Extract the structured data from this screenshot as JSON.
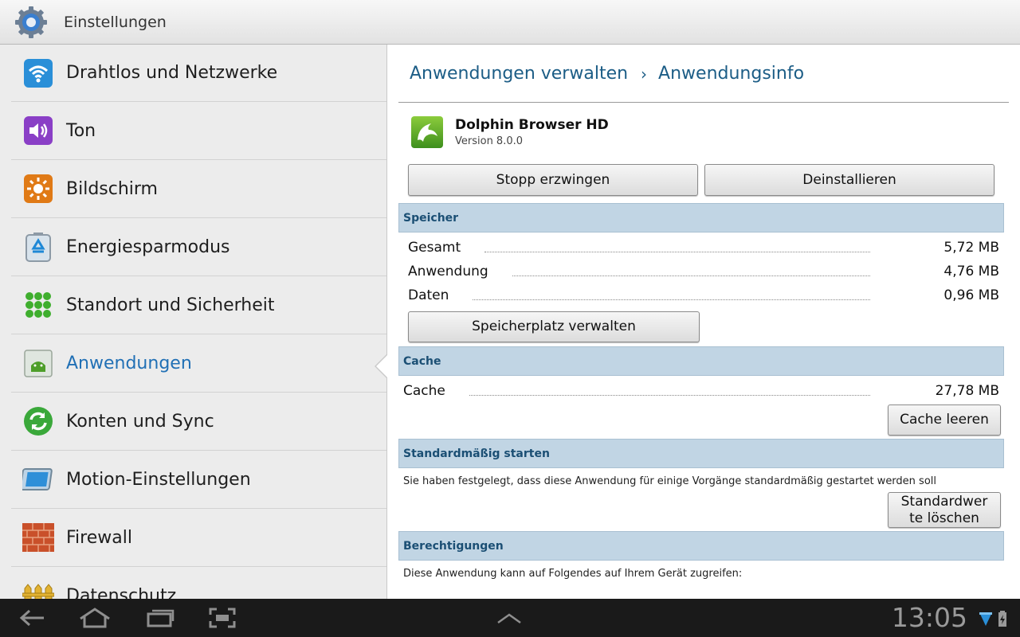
{
  "window": {
    "title": "Einstellungen",
    "icon": "settings-gear-icon"
  },
  "sidebar": {
    "items": [
      {
        "label": "Drahtlos und Netzwerke",
        "icon": "wifi-icon",
        "active": false
      },
      {
        "label": "Ton",
        "icon": "speaker-icon",
        "active": false
      },
      {
        "label": "Bildschirm",
        "icon": "brightness-icon",
        "active": false
      },
      {
        "label": "Energiesparmodus",
        "icon": "battery-recycle-icon",
        "active": false
      },
      {
        "label": "Standort und Sicherheit",
        "icon": "location-grid-icon",
        "active": false
      },
      {
        "label": "Anwendungen",
        "icon": "android-icon",
        "active": true
      },
      {
        "label": "Konten und Sync",
        "icon": "sync-icon",
        "active": false
      },
      {
        "label": "Motion-Einstellungen",
        "icon": "motion-tablet-icon",
        "active": false
      },
      {
        "label": "Firewall",
        "icon": "firewall-brick-icon",
        "active": false
      },
      {
        "label": "Datenschutz",
        "icon": "privacy-fence-icon",
        "active": false
      }
    ]
  },
  "breadcrumb": {
    "parent": "Anwendungen verwalten",
    "separator": "›",
    "current": "Anwendungsinfo"
  },
  "app": {
    "name": "Dolphin Browser HD",
    "version": "Version 8.0.0",
    "icon": "dolphin-icon"
  },
  "actions": {
    "force_stop": "Stopp erzwingen",
    "uninstall": "Deinstallieren"
  },
  "storage": {
    "header": "Speicher",
    "rows": [
      {
        "label": "Gesamt",
        "value": "5,72 MB"
      },
      {
        "label": "Anwendung",
        "value": "4,76 MB"
      },
      {
        "label": "Daten",
        "value": "0,96 MB"
      }
    ],
    "manage_button": "Speicherplatz verwalten"
  },
  "cache": {
    "header": "Cache",
    "label": "Cache",
    "value": "27,78 MB",
    "clear_button": "Cache leeren"
  },
  "defaults": {
    "header": "Standardmäßig starten",
    "text": "Sie haben festgelegt, dass diese Anwendung für einige Vorgänge standardmäßig gestartet werden soll",
    "clear_button_line1": "Standardwer",
    "clear_button_line2": "te löschen"
  },
  "permissions": {
    "header": "Berechtigungen",
    "text": "Diese Anwendung kann auf Folgendes auf Ihrem Gerät zugreifen:"
  },
  "statusbar": {
    "time": "13:05"
  },
  "colors": {
    "active_accent": "#2170b5",
    "section_bg": "#c1d5e4",
    "breadcrumb": "#1c5d86"
  }
}
